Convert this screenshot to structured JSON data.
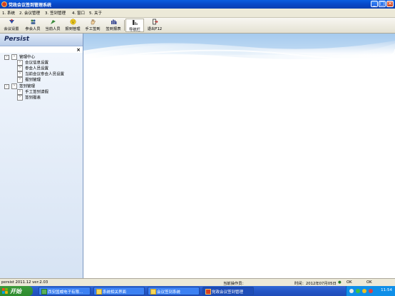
{
  "window": {
    "title": "党政会议签到管理系统",
    "minimize_label": "_",
    "maximize_label": "□",
    "close_label": "×"
  },
  "menu": {
    "items": [
      "1. 系统",
      "2. 会议管理",
      "3. 签到管理",
      "4. 窗口",
      "5. 关于"
    ]
  },
  "toolbar": {
    "buttons": [
      {
        "label": "会议设置",
        "icon": "meeting-icon"
      },
      {
        "label": "参会人员",
        "icon": "people-icon"
      },
      {
        "label": "当前人员",
        "icon": "person-icon"
      },
      {
        "label": "报到管理",
        "icon": "smiley-icon"
      },
      {
        "label": "手工签到",
        "icon": "hand-icon"
      },
      {
        "label": "签到报表",
        "icon": "report-icon"
      },
      {
        "label": "导航栏",
        "icon": "navigator-icon"
      },
      {
        "label": "退出F12",
        "icon": "exit-icon"
      }
    ]
  },
  "left_panel": {
    "title": "Persist",
    "close_label": "×",
    "tree": [
      {
        "label": "管理中心",
        "level": 0,
        "expander": "-"
      },
      {
        "label": "会议信息设置",
        "level": 1
      },
      {
        "label": "参会人员设置",
        "level": 1
      },
      {
        "label": "当前会议参会人员设置",
        "level": 1
      },
      {
        "label": "报到管理",
        "level": 1
      },
      {
        "label": "签到管理",
        "level": 0,
        "expander": "-"
      },
      {
        "label": "手工签到请假",
        "level": 1
      },
      {
        "label": "签到报表",
        "level": 1
      }
    ]
  },
  "status": {
    "version": "persist 2011.12 ver:2.03",
    "operator": "当前操作员：",
    "time": "时间：2012年07月05日",
    "ok1": "OK",
    "ok2": "OK"
  },
  "taskbar": {
    "start_label": "开始",
    "tasks": [
      {
        "label": "西安国威电子有限..."
      },
      {
        "label": "系统相关界面"
      },
      {
        "label": "会议签到系统"
      },
      {
        "label": "党政会议签到管理"
      }
    ],
    "clock": "11:54"
  },
  "colors": {
    "titlebar": "#0a5de0",
    "panel_header": "#b9cde9",
    "taskbar": "#2456c6",
    "start": "#2c8a2c"
  }
}
